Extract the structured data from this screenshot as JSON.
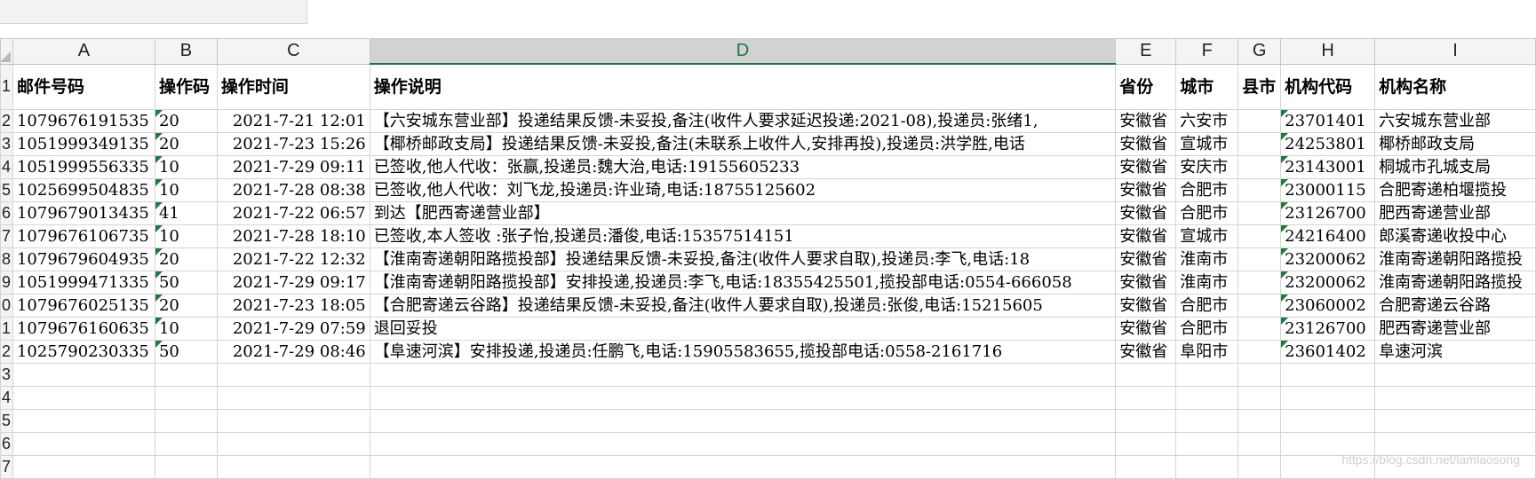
{
  "columns": [
    "A",
    "B",
    "C",
    "D",
    "E",
    "F",
    "G",
    "H",
    "I"
  ],
  "row_numbers": [
    "1",
    "2",
    "3",
    "4",
    "5",
    "6",
    "7",
    "8",
    "9",
    "0",
    "1",
    "2",
    "3",
    "4",
    "5",
    "6",
    "7"
  ],
  "headers": [
    "邮件号码",
    "操作码",
    "操作时间",
    "操作说明",
    "省份",
    "城市",
    "县市",
    "机构代码",
    "机构名称"
  ],
  "rows": [
    [
      "1079676191535",
      "20",
      "2021-7-21 12:01",
      "【六安城东营业部】投递结果反馈-未妥投,备注(收件人要求延迟投递:2021-08),投递员:张绪1,",
      "安徽省",
      "六安市",
      "",
      "23701401",
      "六安城东营业部"
    ],
    [
      "1051999349135",
      "20",
      "2021-7-23 15:26",
      "【椰桥邮政支局】投递结果反馈-未妥投,备注(未联系上收件人,安排再投),投递员:洪学胜,电话",
      "安徽省",
      "宣城市",
      "",
      "24253801",
      "椰桥邮政支局"
    ],
    [
      "1051999556335",
      "10",
      "2021-7-29 09:11",
      "已签收,他人代收：张赢,投递员:魏大治,电话:19155605233",
      "安徽省",
      "安庆市",
      "",
      "23143001",
      "桐城市孔城支局"
    ],
    [
      "1025699504835",
      "10",
      "2021-7-28 08:38",
      "已签收,他人代收：刘飞龙,投递员:许业琦,电话:18755125602",
      "安徽省",
      "合肥市",
      "",
      "23000115",
      "合肥寄递柏堰揽投"
    ],
    [
      "1079679013435",
      "41",
      "2021-7-22 06:57",
      "到达【肥西寄递营业部】",
      "安徽省",
      "合肥市",
      "",
      "23126700",
      "肥西寄递营业部"
    ],
    [
      "1079676106735",
      "10",
      "2021-7-28 18:10",
      "已签收,本人签收 :张子怡,投递员:潘俊,电话:15357514151",
      "安徽省",
      "宣城市",
      "",
      "24216400",
      "郎溪寄递收投中心"
    ],
    [
      "1079679604935",
      "20",
      "2021-7-22 12:32",
      "【淮南寄递朝阳路揽投部】投递结果反馈-未妥投,备注(收件人要求自取),投递员:李飞,电话:18",
      "安徽省",
      "淮南市",
      "",
      "23200062",
      "淮南寄递朝阳路揽投"
    ],
    [
      "1051999471335",
      "50",
      "2021-7-29 09:17",
      "【淮南寄递朝阳路揽投部】安排投递,投递员:李飞,电话:18355425501,揽投部电话:0554-666058",
      "安徽省",
      "淮南市",
      "",
      "23200062",
      "淮南寄递朝阳路揽投"
    ],
    [
      "1079676025135",
      "20",
      "2021-7-23 18:05",
      "【合肥寄递云谷路】投递结果反馈-未妥投,备注(收件人要求自取),投递员:张俊,电话:15215605",
      "安徽省",
      "合肥市",
      "",
      "23060002",
      "合肥寄递云谷路"
    ],
    [
      "1079676160635",
      "10",
      "2021-7-29 07:59",
      "退回妥投",
      "安徽省",
      "合肥市",
      "",
      "23126700",
      "肥西寄递营业部"
    ],
    [
      "1025790230335",
      "50",
      "2021-7-29 08:46",
      "【阜速河滨】安排投递,投递员:任鹏飞,电话:15905583655,揽投部电话:0558-2161716",
      "安徽省",
      "阜阳市",
      "",
      "23601402",
      "阜速河滨"
    ]
  ],
  "watermark": "https://blog.csdn.net/lamlaosong"
}
